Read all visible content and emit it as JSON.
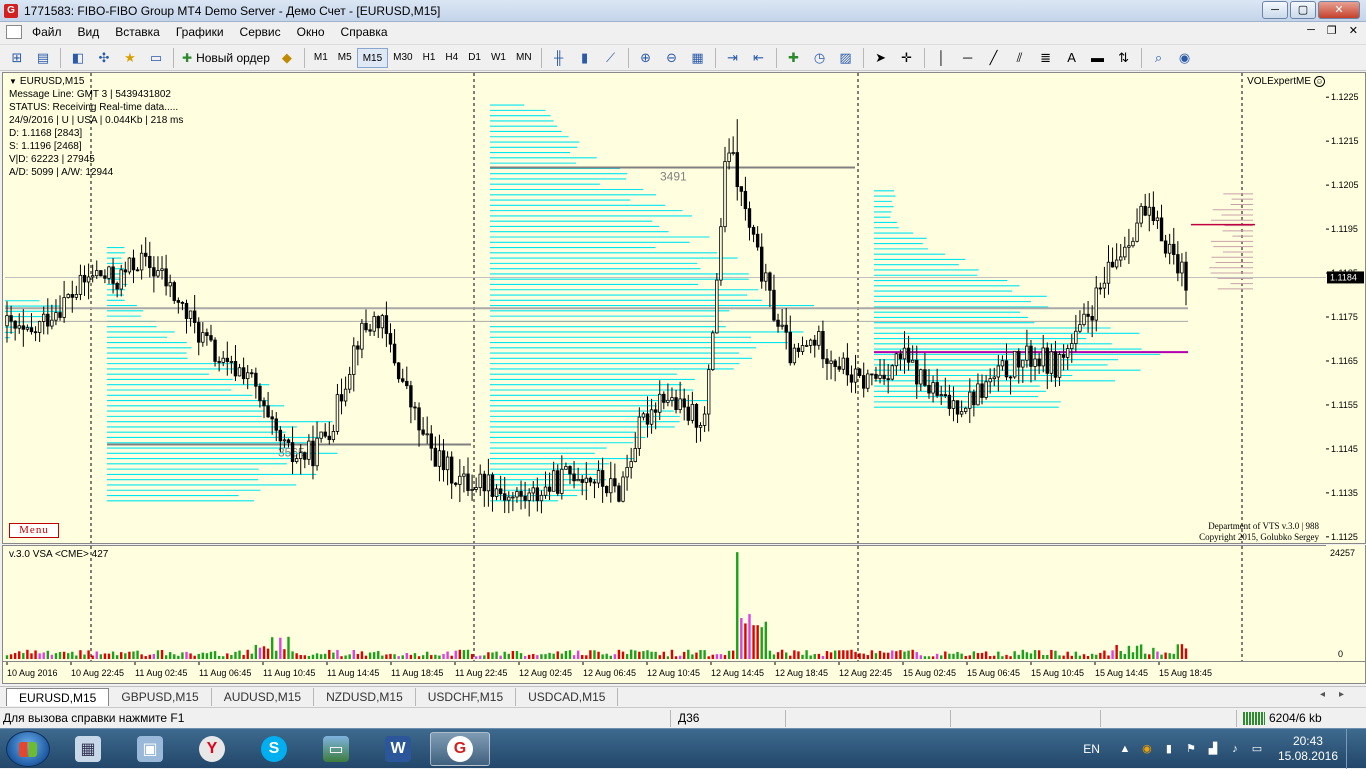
{
  "window": {
    "title": "1771583: FIBO-FIBO Group MT4 Demo Server - Демо Счет - [EURUSD,M15]",
    "app_icon": "G",
    "controls": {
      "min": "─",
      "max": "▢",
      "close": "✕"
    }
  },
  "menu": {
    "items": [
      "Файл",
      "Вид",
      "Вставка",
      "Графики",
      "Сервис",
      "Окно",
      "Справка"
    ],
    "right_controls": {
      "min": "─",
      "restore": "❐",
      "close": "✕"
    }
  },
  "toolbar": {
    "new_order_label": "Новый ордер",
    "timeframes": [
      "M1",
      "M5",
      "M15",
      "M30",
      "H1",
      "H4",
      "D1",
      "W1",
      "MN"
    ],
    "active_timeframe": "M15"
  },
  "chart": {
    "symbol_label": "EURUSD,M15",
    "info_lines": [
      "Message Line: GMT 3 | 5439431802",
      "STATUS:  Receiving Real-time data.....",
      "24/9/2016 | U | USA | 0.044Kb | 218 ms",
      "D: 1.1168  [2843]",
      "S: 1.1196  [2468]",
      "V|D: 62223 | 27945",
      "A/D: 5099 | A/W: 12944"
    ],
    "expert_name": "VOLExpertME",
    "menu_button": "Menu",
    "copyright_lines": [
      "Department of VTS  v.3.0 | 988",
      "Copyright 2015, Golubko Sergey"
    ],
    "profile_labels": [
      "3491",
      "3565"
    ],
    "current_price": "1.1184",
    "price_ticks": [
      "1.1225",
      "1.1215",
      "1.1205",
      "1.1195",
      "1.1185",
      "1.1175",
      "1.1165",
      "1.1155",
      "1.1145",
      "1.1135",
      "1.1125"
    ],
    "volume_label": "v.3.0 VSA <CME> 427",
    "volume_scale": [
      "24257",
      "0"
    ],
    "time_labels": [
      "10 Aug 2016",
      "10 Aug 22:45",
      "11 Aug 02:45",
      "11 Aug 06:45",
      "11 Aug 10:45",
      "11 Aug 14:45",
      "11 Aug 18:45",
      "11 Aug 22:45",
      "12 Aug 02:45",
      "12 Aug 06:45",
      "12 Aug 10:45",
      "12 Aug 14:45",
      "12 Aug 18:45",
      "12 Aug 22:45",
      "15 Aug 02:45",
      "15 Aug 06:45",
      "15 Aug 10:45",
      "15 Aug 14:45",
      "15 Aug 18:45"
    ],
    "colors": {
      "background": "#ffffe0",
      "profile": "#00e5ee",
      "candle": "#000000",
      "vol_up": "#1aa31a",
      "vol_down": "#e00000",
      "vol_climax": "#e040e0",
      "poc_line": "#808080",
      "level_line": "#b000b0"
    }
  },
  "chart_data": {
    "type": "candlestick",
    "symbol": "EURUSD",
    "timeframe": "M15",
    "ylim": [
      1.1122,
      1.1232
    ],
    "y_ticks": [
      1.1125,
      1.1135,
      1.1145,
      1.1155,
      1.1165,
      1.1175,
      1.1185,
      1.1195,
      1.1205,
      1.1215,
      1.1225
    ],
    "x_labels": [
      "10 Aug 2016",
      "10 Aug 22:45",
      "11 Aug 02:45",
      "11 Aug 06:45",
      "11 Aug 10:45",
      "11 Aug 14:45",
      "11 Aug 18:45",
      "11 Aug 22:45",
      "12 Aug 02:45",
      "12 Aug 06:45",
      "12 Aug 10:45",
      "12 Aug 14:45",
      "12 Aug 18:45",
      "12 Aug 22:45",
      "15 Aug 02:45",
      "15 Aug 06:45",
      "15 Aug 10:45",
      "15 Aug 14:45",
      "15 Aug 18:45"
    ],
    "close_path": [
      1.1173,
      1.117,
      1.1176,
      1.118,
      1.1185,
      1.1183,
      1.1188,
      1.1185,
      1.1177,
      1.117,
      1.1163,
      1.1163,
      1.115,
      1.1143,
      1.1144,
      1.1152,
      1.117,
      1.1175,
      1.1162,
      1.1148,
      1.1141,
      1.1137,
      1.1138,
      1.1134,
      1.1134,
      1.1137,
      1.114,
      1.1138,
      1.1135,
      1.115,
      1.1158,
      1.1153,
      1.1152,
      1.1215,
      1.1195,
      1.1178,
      1.1165,
      1.117,
      1.1165,
      1.116,
      1.1162,
      1.1166,
      1.116,
      1.1155,
      1.1156,
      1.116,
      1.1164,
      1.1166,
      1.1164,
      1.117,
      1.118,
      1.119,
      1.1199,
      1.1193,
      1.1184
    ],
    "current_price": 1.1184,
    "horizontal_levels": [
      {
        "price": 1.1209,
        "label": "3491"
      },
      {
        "price": 1.1146,
        "label": "3565"
      },
      {
        "price": 1.1177
      },
      {
        "price": 1.1174
      },
      {
        "price": 1.1167
      }
    ],
    "volume_ylim": [
      0,
      24257
    ]
  },
  "tabs": {
    "items": [
      "EURUSD,M15",
      "GBPUSD,M15",
      "AUDUSD,M15",
      "NZDUSD,M15",
      "USDCHF,M15",
      "USDCAD,M15"
    ],
    "active": "EURUSD,M15"
  },
  "status": {
    "help": "Для вызова справки нажмите F1",
    "profile": "Д36",
    "connection": "6204/6 kb"
  },
  "taskbar": {
    "language": "EN",
    "time": "20:43",
    "date": "15.08.2016",
    "apps": [
      "calculator",
      "computer",
      "yandex-browser",
      "skype",
      "image-viewer",
      "word",
      "fibo-group-mt4"
    ]
  }
}
